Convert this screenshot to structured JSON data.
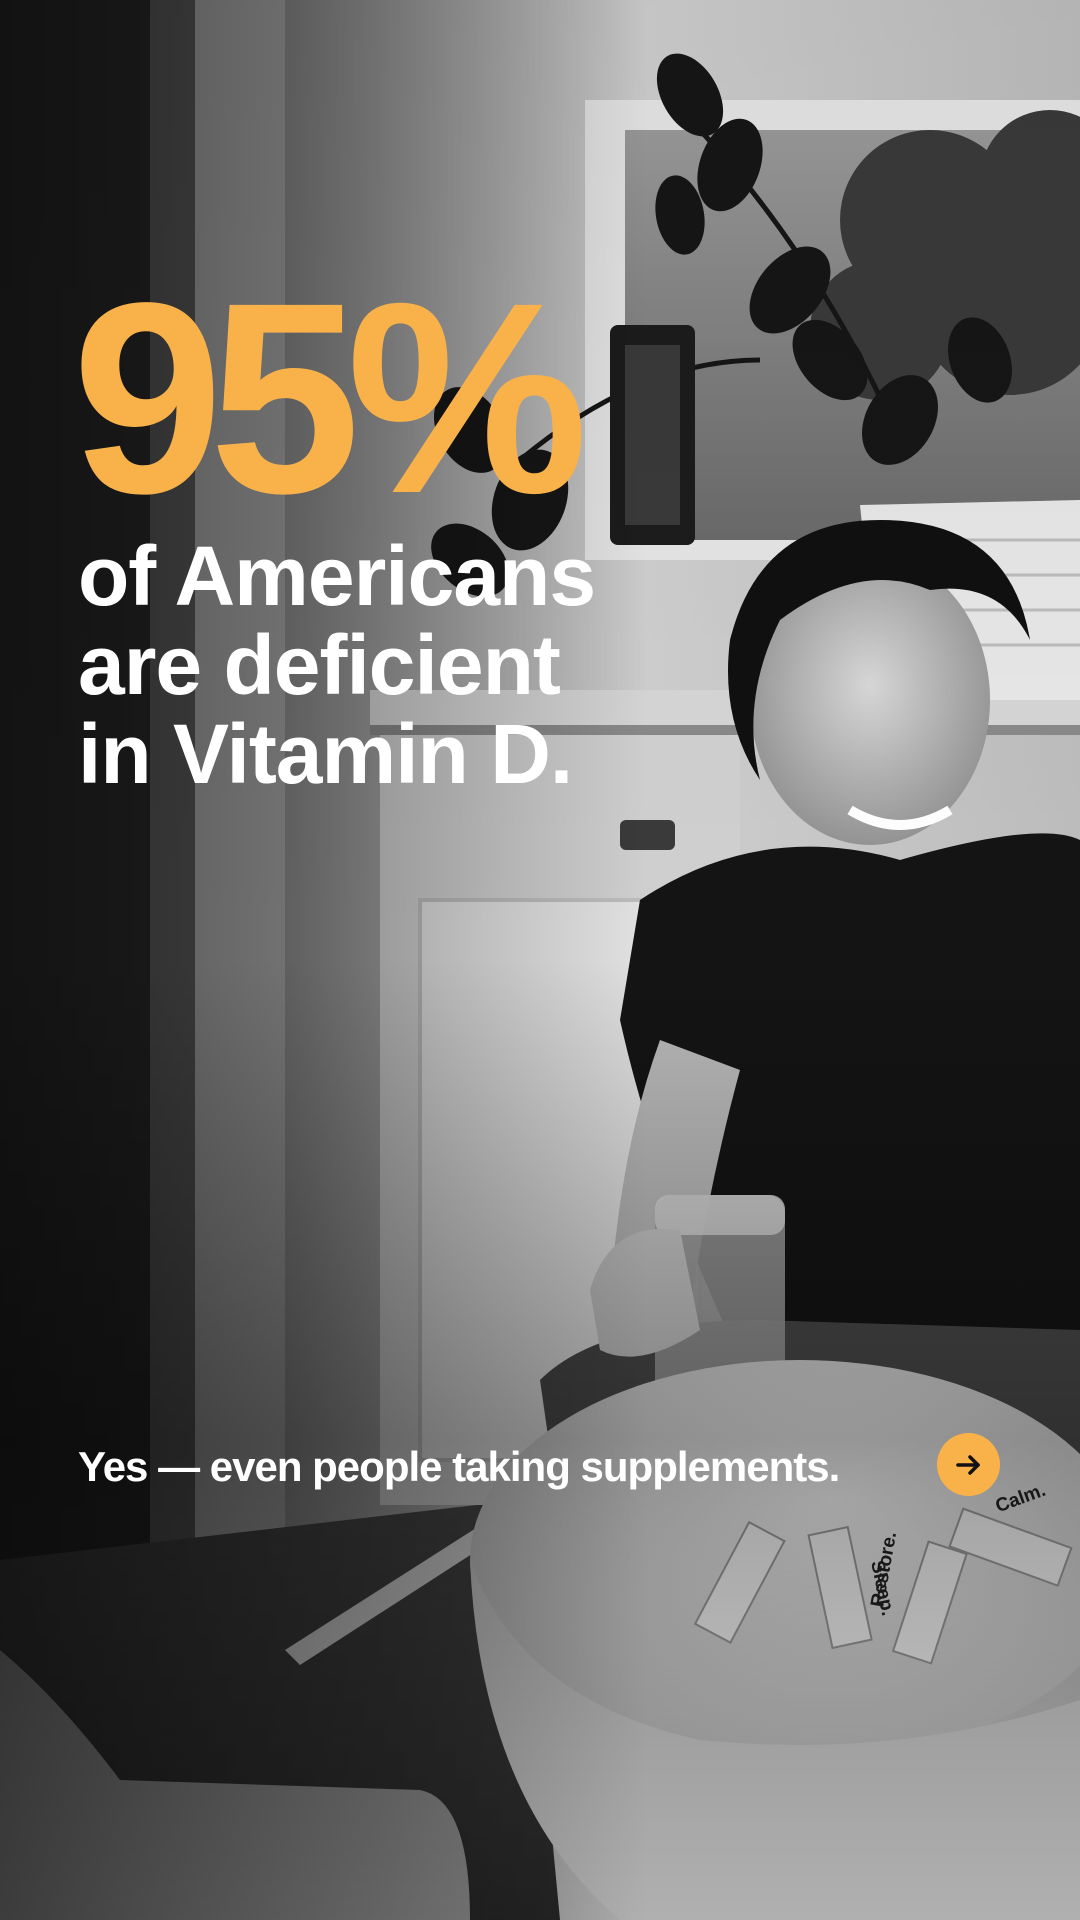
{
  "stat": {
    "value": "95%"
  },
  "headline": {
    "lines": [
      "of Americans",
      "are deficient",
      "in Vitamin D."
    ]
  },
  "subline": "Yes — even people taking supplements.",
  "next_button": {
    "icon": "arrow-right-icon"
  },
  "photo": {
    "packet_labels": [
      "Sleep.",
      "Restore.",
      "Calm."
    ]
  },
  "colors": {
    "accent": "#F9B24A",
    "text": "#FFFFFF",
    "arrow": "#111111"
  }
}
